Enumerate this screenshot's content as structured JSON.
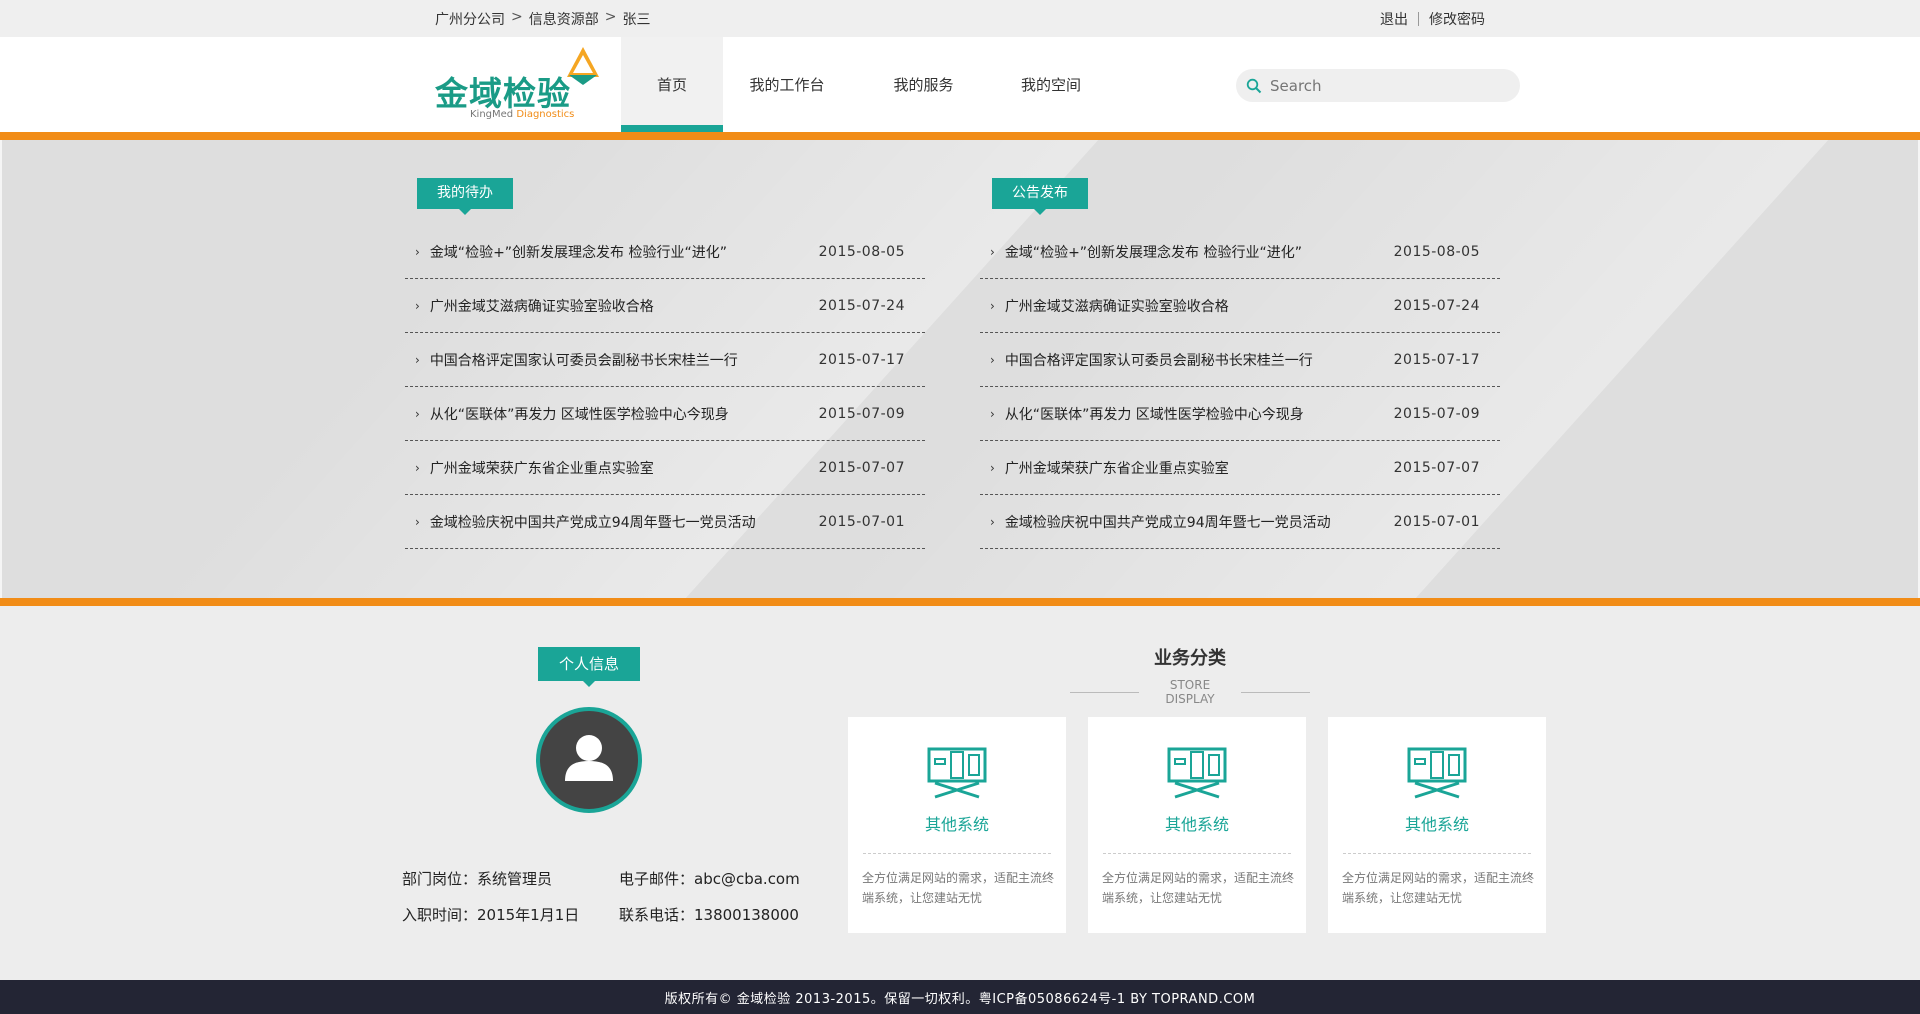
{
  "topbar": {
    "breadcrumb": [
      "广州分公司",
      "信息资源部",
      "张三"
    ],
    "breadcrumb_sep": ">",
    "logout": "退出",
    "change_password": "修改密码"
  },
  "logo": {
    "cn": "金域检验",
    "en_a": "KingMed",
    "en_b": "Diagnostics"
  },
  "nav": [
    {
      "label": "首页",
      "active": true
    },
    {
      "label": "我的工作台"
    },
    {
      "label": "我的服务"
    },
    {
      "label": "我的空间"
    }
  ],
  "search": {
    "placeholder": "Search"
  },
  "todo": {
    "title": "我的待办",
    "items": [
      {
        "title": "金域“检验+”创新发展理念发布 检验行业“进化”",
        "date": "2015-08-05"
      },
      {
        "title": "广州金域艾滋病确证实验室验收合格",
        "date": "2015-07-24"
      },
      {
        "title": "中国合格评定国家认可委员会副秘书长宋桂兰一行",
        "date": "2015-07-17"
      },
      {
        "title": "从化“医联体”再发力 区域性医学检验中心今现身",
        "date": "2015-07-09"
      },
      {
        "title": "广州金域荣获广东省企业重点实验室",
        "date": "2015-07-07"
      },
      {
        "title": "金域检验庆祝中国共产党成立94周年暨七一党员活动",
        "date": "2015-07-01"
      }
    ]
  },
  "notice": {
    "title": "公告发布",
    "items": [
      {
        "title": "金域“检验+”创新发展理念发布 检验行业“进化”",
        "date": "2015-08-05"
      },
      {
        "title": "广州金域艾滋病确证实验室验收合格",
        "date": "2015-07-24"
      },
      {
        "title": "中国合格评定国家认可委员会副秘书长宋桂兰一行",
        "date": "2015-07-17"
      },
      {
        "title": "从化“医联体”再发力 区域性医学检验中心今现身",
        "date": "2015-07-09"
      },
      {
        "title": "广州金域荣获广东省企业重点实验室",
        "date": "2015-07-07"
      },
      {
        "title": "金域检验庆祝中国共产党成立94周年暨七一党员活动",
        "date": "2015-07-01"
      }
    ]
  },
  "profile": {
    "title": "个人信息",
    "dept": "部门岗位：系统管理员",
    "email": "电子邮件：abc@cba.com",
    "join": "入职时间：2015年1月1日",
    "phone": "联系电话：13800138000"
  },
  "business": {
    "title": "业务分类",
    "subtitle": "STORE DISPLAY",
    "cards": [
      {
        "title": "其他系统",
        "desc": "全方位满足网站的需求，适配主流终端系统，让您建站无忧"
      },
      {
        "title": "其他系统",
        "desc": "全方位满足网站的需求，适配主流终端系统，让您建站无忧"
      },
      {
        "title": "其他系统",
        "desc": "全方位满足网站的需求，适配主流终端系统，让您建站无忧"
      }
    ]
  },
  "footer": {
    "text": "版权所有© 金域检验 2013-2015。保留一切权利。粤ICP备05086624号-1 BY TOPRAND.COM"
  },
  "colors": {
    "accent": "#1aa597",
    "orange": "#f18c17",
    "footer_bg": "#232534"
  }
}
